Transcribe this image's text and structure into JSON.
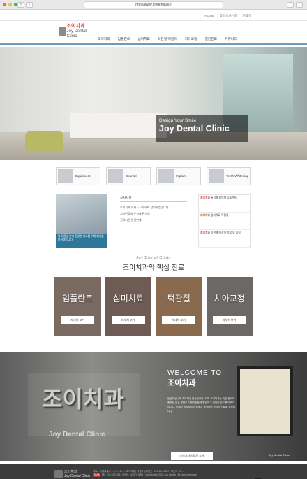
{
  "browser": {
    "url": "http://www.joydental.kr/",
    "controls": {
      "back": "‹",
      "forward": "›"
    }
  },
  "top_links": [
    "HOME",
    "찾아오시는길",
    "진료실"
  ],
  "header": {
    "logo_main": "조이치과",
    "logo_sub": "Joy Dental Clinic",
    "nav": [
      "조이치과",
      "임플란트",
      "심미치료",
      "턱관절/이갈이",
      "치아교정",
      "일반진료",
      "커뮤니티"
    ]
  },
  "hero": {
    "subtitle": "Design Your Smile",
    "title": "Joy Dental Clinic"
  },
  "quick": [
    {
      "label": "Equipment"
    },
    {
      "label": "Counsel"
    },
    {
      "label": "Implant"
    },
    {
      "label": "Teeth Whitening"
    }
  ],
  "notice": {
    "title": "공지사항",
    "items": [
      "조이치과 의사 ○○ 이 학회 참석하였습니다",
      "치과진료실 운영에 관하여",
      "진료시간 변경안내"
    ],
    "photo_caption": "의료 환경 안내 건강한 미소를 위해 최선을 다하겠습니다"
  },
  "promo": [
    {
      "brand": "조이치과",
      "text": "통합형 레이저 임플란트"
    },
    {
      "brand": "조이치과",
      "text": "심미치료 특장점"
    },
    {
      "brand": "조이치과",
      "text": "턱관절/이갈이 치료 및 교정"
    }
  ],
  "section": {
    "en": "Joy Dental Clinic",
    "ko": "조이치과의 핵심 진료"
  },
  "cards": [
    {
      "name": "임플란트",
      "button": "자세히 보기",
      "color": "#7a6a62"
    },
    {
      "name": "심미치료",
      "button": "자세히 보기",
      "color": "#6e5b54"
    },
    {
      "name": "턱관절",
      "button": "자세히 보기",
      "color": "#8a6a4f"
    },
    {
      "name": "치아교정",
      "button": "자세히 보기",
      "color": "#6b6866"
    }
  ],
  "welcome": {
    "sign_ko": "조이치과",
    "sign_en": "Joy Dental Clinic",
    "title_en": "WELCOME TO",
    "title_ko": "조이치과",
    "paragraph": "안녕하십니까 조이치과 원장입니다. 저희 조이치과는 최신 장비와 풍부한 임상 경험으로 환자분들께 편안하고 안전한 진료를 약속드립니다. 언제나 환자분의 입장에서 생각하며 정직한 진료를 하겠습니다.",
    "button": "조이치과 의료진 소개",
    "tag": "Joy Dental Clinic"
  },
  "footer": {
    "logo_main": "조이치과",
    "logo_sub": "Joy Dental Clinic",
    "line1": "주소 : 서울특별시 ○○구 ○○로 ○○ 조이치과 | 사업자등록번호 : 123-45-67890 | 대표자 : 이○○",
    "line2": "TEL : 02-927-0987 | FAX : 02-927-3094 | Copyright(c) 2021 Joy Dental . All rights reserved.",
    "badge": "KIAA",
    "top": "▲"
  },
  "colors": {
    "accent_blue": "#6b9bc3",
    "brand_red": "#d94c3a",
    "footer_bg": "#3b3b3b"
  }
}
